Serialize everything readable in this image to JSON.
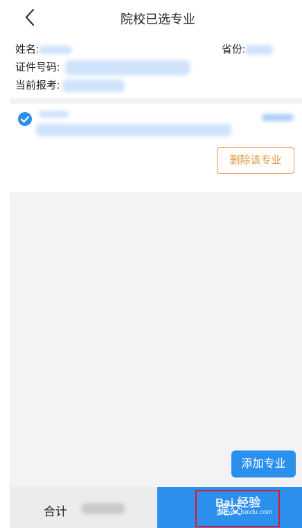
{
  "header": {
    "title": "院校已选专业",
    "back_icon": "chevron-left-icon"
  },
  "info": {
    "name_label": "姓名:",
    "province_label": "省份:",
    "id_label": "证件号码:",
    "current_label": "当前报考:"
  },
  "major_card": {
    "selected_icon": "check-circle-icon",
    "delete_label": "删除该专业"
  },
  "actions": {
    "add_label": "添加专业"
  },
  "footer": {
    "total_label": "合计",
    "submit_label": "提交"
  },
  "watermark": {
    "brand": "Bai 经验",
    "url": "jingyan.baidu.com"
  },
  "colors": {
    "accent": "#2b8fed",
    "delete": "#e8913b",
    "highlight": "#e0182b",
    "background": "#f3f3f5"
  }
}
